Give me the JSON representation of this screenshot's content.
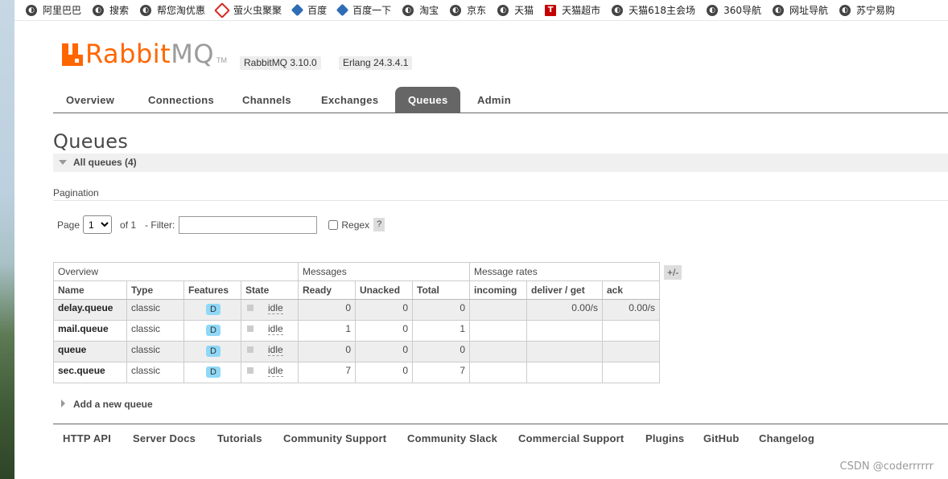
{
  "bookmarks": [
    {
      "label": "阿里巴巴",
      "icon": "globe-icon"
    },
    {
      "label": "搜索",
      "icon": "globe-icon"
    },
    {
      "label": "帮您淘优惠",
      "icon": "globe-icon"
    },
    {
      "label": "萤火虫聚聚",
      "icon": "diamond-icon"
    },
    {
      "label": "百度",
      "icon": "paw-icon"
    },
    {
      "label": "百度一下",
      "icon": "paw-icon"
    },
    {
      "label": "淘宝",
      "icon": "globe-icon"
    },
    {
      "label": "京东",
      "icon": "globe-icon"
    },
    {
      "label": "天猫",
      "icon": "globe-icon"
    },
    {
      "label": "天猫超市",
      "icon": "tmall-icon",
      "icon_text": "T"
    },
    {
      "label": "天猫618主会场",
      "icon": "globe-icon"
    },
    {
      "label": "360导航",
      "icon": "globe-icon"
    },
    {
      "label": "网址导航",
      "icon": "globe-icon"
    },
    {
      "label": "苏宁易购",
      "icon": "globe-icon"
    }
  ],
  "header": {
    "logo_rabbit": "Rabbit",
    "logo_mq": "MQ",
    "logo_tm": "TM",
    "rabbitmq_version": "RabbitMQ 3.10.0",
    "erlang_version": "Erlang 24.3.4.1"
  },
  "tabs": [
    "Overview",
    "Connections",
    "Channels",
    "Exchanges",
    "Queues",
    "Admin"
  ],
  "active_tab": "Queues",
  "page": {
    "title": "Queues",
    "section_label": "All queues (4)",
    "pagination_label": "Pagination"
  },
  "pagination": {
    "page_label": "Page",
    "page_value": "1",
    "of_label": "of 1",
    "filter_label": "- Filter:",
    "filter_value": "",
    "regex_label": "Regex",
    "help_label": "?"
  },
  "table": {
    "groups": [
      "Overview",
      "Messages",
      "Message rates"
    ],
    "columns": [
      "Name",
      "Type",
      "Features",
      "State",
      "Ready",
      "Unacked",
      "Total",
      "incoming",
      "deliver / get",
      "ack"
    ],
    "toggle_label": "+/-",
    "rows": [
      {
        "name": "delay.queue",
        "type": "classic",
        "feature": "D",
        "state": "idle",
        "ready": "0",
        "unacked": "0",
        "total": "0",
        "incoming": "",
        "deliver_get": "0.00/s",
        "ack": "0.00/s"
      },
      {
        "name": "mail.queue",
        "type": "classic",
        "feature": "D",
        "state": "idle",
        "ready": "1",
        "unacked": "0",
        "total": "1",
        "incoming": "",
        "deliver_get": "",
        "ack": ""
      },
      {
        "name": "queue",
        "type": "classic",
        "feature": "D",
        "state": "idle",
        "ready": "0",
        "unacked": "0",
        "total": "0",
        "incoming": "",
        "deliver_get": "",
        "ack": ""
      },
      {
        "name": "sec.queue",
        "type": "classic",
        "feature": "D",
        "state": "idle",
        "ready": "7",
        "unacked": "0",
        "total": "7",
        "incoming": "",
        "deliver_get": "",
        "ack": ""
      }
    ]
  },
  "add_queue_label": "Add a new queue",
  "footer_links": [
    "HTTP API",
    "Server Docs",
    "Tutorials",
    "Community Support",
    "Community Slack",
    "Commercial Support",
    "Plugins",
    "GitHub",
    "Changelog"
  ],
  "watermark": "CSDN @coderrrrrr",
  "colors": {
    "brand": "#ff6600",
    "active_tab": "#666666",
    "feature_badge": "#8fd8f7"
  }
}
